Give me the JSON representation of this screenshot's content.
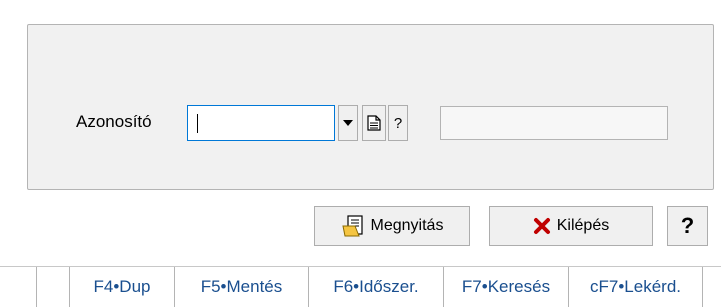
{
  "form": {
    "id_label": "Azonosító",
    "id_value": "",
    "readonly_value": "",
    "help_mini": "?"
  },
  "actions": {
    "open_label": "Megnyitás",
    "exit_label": "Kilépés",
    "help_label": "?"
  },
  "statusbar": {
    "items": [
      "F4•Dup",
      "F5•Mentés",
      "F6•Időszer.",
      "F7•Keresés",
      "cF7•Lekérd."
    ]
  },
  "colors": {
    "status_text": "#1a4f8f",
    "exit_icon": "#c00000",
    "focus_border": "#0078d7"
  },
  "icons": {
    "dropdown": "triangle-down-icon",
    "document": "document-icon",
    "open": "open-document-icon",
    "exit": "red-x-icon"
  }
}
